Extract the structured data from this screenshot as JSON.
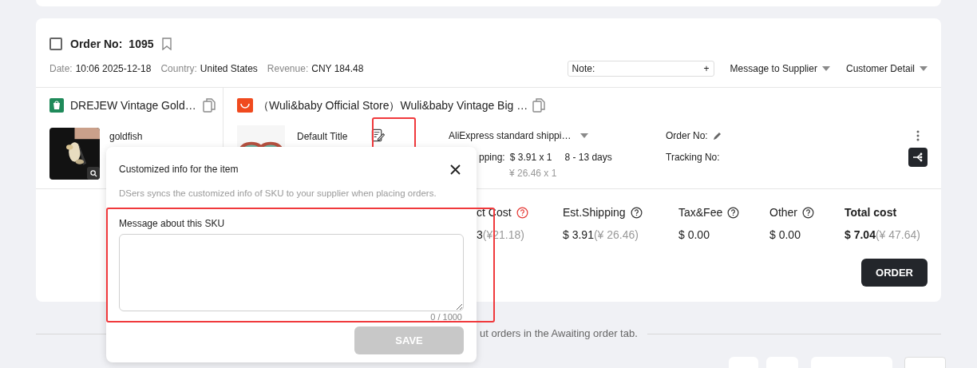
{
  "order": {
    "checked": false,
    "label": "Order No:",
    "number": "1095"
  },
  "meta": [
    {
      "label": "Date:",
      "value": "10:06 2025-12-18"
    },
    {
      "label": "Country:",
      "value": "United States"
    },
    {
      "label": "Revenue:",
      "value": "CNY 184.48"
    }
  ],
  "note": {
    "label": "Note:",
    "add": "+"
  },
  "dropdowns": [
    "Message to Supplier",
    "Customer Detail"
  ],
  "shop_item": {
    "title": "DREJEW Vintage Gold…",
    "variant": "goldfish"
  },
  "supplier_item": {
    "store": "（Wuli&baby Official Store）Wuli&baby Vintage Big …",
    "variant": "Default Title",
    "shipping_method": "AliExpress standard shippi…",
    "shipping_label": "pping:",
    "shipping_price": "$ 3.91 x 1",
    "delivery": "8 - 13 days",
    "shipping_price_cny": "¥ 26.46 x 1",
    "order_no_label": "Order No:",
    "tracking_label": "Tracking No:"
  },
  "costs": [
    {
      "kind": "partial",
      "label": "ct Cost",
      "warning": true,
      "value": "3",
      "value_cny": "(¥21.18)"
    },
    {
      "kind": "normal",
      "label": "Est.Shipping",
      "warning": false,
      "value": "$ 3.91",
      "value_cny": "(¥ 26.46)"
    },
    {
      "kind": "normal",
      "label": "Tax&Fee",
      "warning": false,
      "value": "$ 0.00"
    },
    {
      "kind": "normal",
      "label": "Other",
      "warning": false,
      "value": "$ 0.00"
    },
    {
      "kind": "total",
      "label": "Total cost",
      "value": "$ 7.04",
      "value_cny": "(¥ 47.64)"
    }
  ],
  "order_button": "ORDER",
  "footer_text": "ut orders in the Awaiting order tab.",
  "popover": {
    "title": "Customized info for the item",
    "description": "DSers syncs the customized info of SKU to your supplier when placing orders.",
    "field_label": "Message about this SKU",
    "counter": "0 / 1000",
    "save_label": "SAVE",
    "save_disabled": true
  }
}
